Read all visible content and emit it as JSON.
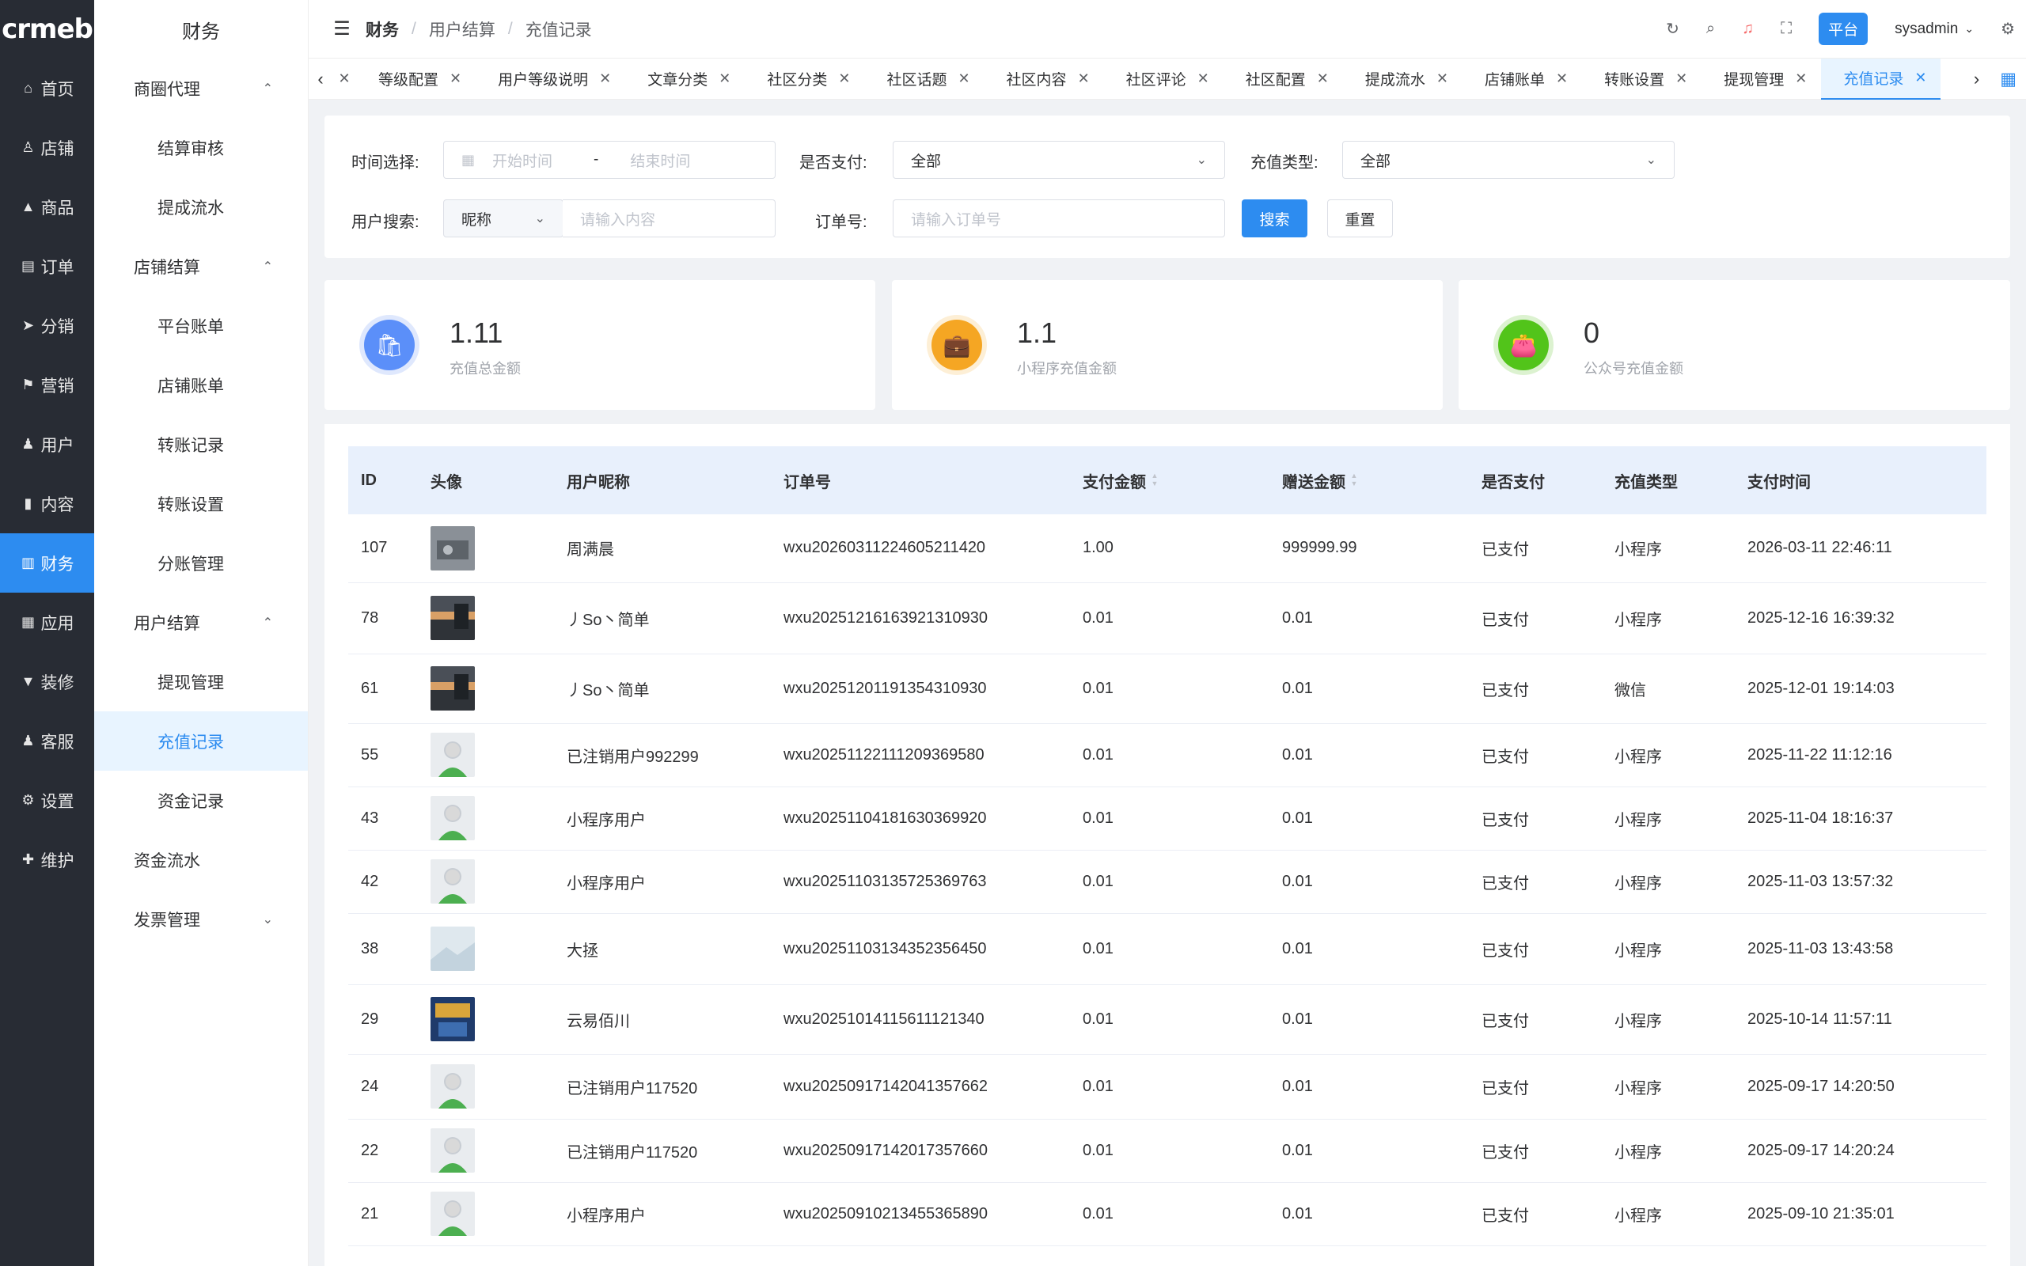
{
  "nav": {
    "logo": "crmeb",
    "items": [
      {
        "label": "首页",
        "icon": "home-icon",
        "glyph": "⌂"
      },
      {
        "label": "店铺",
        "icon": "store-icon",
        "glyph": "♙"
      },
      {
        "label": "商品",
        "icon": "bag-icon",
        "glyph": "▲"
      },
      {
        "label": "订单",
        "icon": "order-icon",
        "glyph": "▤"
      },
      {
        "label": "分销",
        "icon": "send-icon",
        "glyph": "➤"
      },
      {
        "label": "营销",
        "icon": "flag-icon",
        "glyph": "⚑"
      },
      {
        "label": "用户",
        "icon": "user-icon",
        "glyph": "♟"
      },
      {
        "label": "内容",
        "icon": "content-icon",
        "glyph": "▮"
      },
      {
        "label": "财务",
        "icon": "finance-chart-icon",
        "glyph": "▥"
      },
      {
        "label": "应用",
        "icon": "apps-icon",
        "glyph": "▦"
      },
      {
        "label": "装修",
        "icon": "brush-icon",
        "glyph": "▼"
      },
      {
        "label": "客服",
        "icon": "service-icon",
        "glyph": "♟"
      },
      {
        "label": "设置",
        "icon": "settings-icon",
        "glyph": "⚙"
      },
      {
        "label": "维护",
        "icon": "maintain-icon",
        "glyph": "✚"
      }
    ]
  },
  "sidebar": {
    "title": "财务",
    "entries": [
      {
        "type": "group",
        "label": "商圈代理",
        "arrow": "⌃"
      },
      {
        "type": "item",
        "label": "结算审核"
      },
      {
        "type": "item",
        "label": "提成流水"
      },
      {
        "type": "group",
        "label": "店铺结算",
        "arrow": "⌃"
      },
      {
        "type": "item",
        "label": "平台账单"
      },
      {
        "type": "item",
        "label": "店铺账单"
      },
      {
        "type": "item",
        "label": "转账记录"
      },
      {
        "type": "item",
        "label": "转账设置"
      },
      {
        "type": "item",
        "label": "分账管理"
      },
      {
        "type": "group",
        "label": "用户结算",
        "arrow": "⌃"
      },
      {
        "type": "item",
        "label": "提现管理"
      },
      {
        "type": "item",
        "label": "充值记录",
        "active": true
      },
      {
        "type": "item",
        "label": "资金记录"
      },
      {
        "type": "group",
        "label": "资金流水",
        "arrow": ""
      },
      {
        "type": "group",
        "label": "发票管理",
        "arrow": "⌄"
      }
    ]
  },
  "header": {
    "crumbs": [
      "财务",
      "用户结算",
      "充值记录"
    ],
    "platform_label": "平台",
    "username": "sysadmin"
  },
  "tabs": {
    "items": [
      "等级配置",
      "用户等级说明",
      "文章分类",
      "社区分类",
      "社区话题",
      "社区内容",
      "社区评论",
      "社区配置",
      "提成流水",
      "店铺账单",
      "转账设置",
      "提现管理",
      "充值记录"
    ],
    "active_index": 12
  },
  "filter": {
    "time_label": "时间选择:",
    "start_placeholder": "开始时间",
    "range_sep": "-",
    "end_placeholder": "结束时间",
    "paid_label": "是否支付:",
    "paid_value": "全部",
    "type_label": "充值类型:",
    "type_value": "全部",
    "user_search_label": "用户搜索:",
    "user_field_value": "昵称",
    "user_search_placeholder": "请输入内容",
    "order_label": "订单号:",
    "order_placeholder": "请输入订单号",
    "search_btn": "搜索",
    "reset_btn": "重置"
  },
  "stats": [
    {
      "value": "1.11",
      "label": "充值总金额",
      "color": "#5b8ff9",
      "ring": "#dfe8fd",
      "icon": "shopping-bag-icon",
      "glyph": "🛍"
    },
    {
      "value": "1.1",
      "label": "小程序充值金额",
      "color": "#f5a623",
      "ring": "#fdefd6",
      "icon": "briefcase-icon",
      "glyph": "💼"
    },
    {
      "value": "0",
      "label": "公众号充值金额",
      "color": "#52c41a",
      "ring": "#dcf2d0",
      "icon": "wallet-icon",
      "glyph": "👛"
    }
  ],
  "table": {
    "columns": [
      "ID",
      "头像",
      "用户昵称",
      "订单号",
      "支付金额",
      "赠送金额",
      "是否支付",
      "充值类型",
      "支付时间"
    ],
    "rows": [
      {
        "id": "107",
        "avatar": "photo-gray",
        "nick": "周满晨",
        "order": "wxu20260311224605211420",
        "pay": "1.00",
        "gift": "999999.99",
        "paid": "已支付",
        "type": "小程序",
        "time": "2026-03-11 22:46:11"
      },
      {
        "id": "78",
        "avatar": "photo-sunset",
        "nick": "丿So丶简单",
        "order": "wxu20251216163921310930",
        "pay": "0.01",
        "gift": "0.01",
        "paid": "已支付",
        "type": "小程序",
        "time": "2025-12-16 16:39:32"
      },
      {
        "id": "61",
        "avatar": "photo-sunset",
        "nick": "丿So丶简单",
        "order": "wxu20251201191354310930",
        "pay": "0.01",
        "gift": "0.01",
        "paid": "已支付",
        "type": "微信",
        "time": "2025-12-01 19:14:03"
      },
      {
        "id": "55",
        "avatar": "default",
        "nick": "已注销用户992299",
        "order": "wxu20251122111209369580",
        "pay": "0.01",
        "gift": "0.01",
        "paid": "已支付",
        "type": "小程序",
        "time": "2025-11-22 11:12:16"
      },
      {
        "id": "43",
        "avatar": "default",
        "nick": "小程序用户",
        "order": "wxu20251104181630369920",
        "pay": "0.01",
        "gift": "0.01",
        "paid": "已支付",
        "type": "小程序",
        "time": "2025-11-04 18:16:37"
      },
      {
        "id": "42",
        "avatar": "default",
        "nick": "小程序用户",
        "order": "wxu20251103135725369763",
        "pay": "0.01",
        "gift": "0.01",
        "paid": "已支付",
        "type": "小程序",
        "time": "2025-11-03 13:57:32"
      },
      {
        "id": "38",
        "avatar": "photo-light",
        "nick": "大拯",
        "order": "wxu20251103134352356450",
        "pay": "0.01",
        "gift": "0.01",
        "paid": "已支付",
        "type": "小程序",
        "time": "2025-11-03 13:43:58"
      },
      {
        "id": "29",
        "avatar": "photo-poster",
        "nick": "云易佰川",
        "order": "wxu20251014115611121340",
        "pay": "0.01",
        "gift": "0.01",
        "paid": "已支付",
        "type": "小程序",
        "time": "2025-10-14 11:57:11"
      },
      {
        "id": "24",
        "avatar": "default",
        "nick": "已注销用户117520",
        "order": "wxu20250917142041357662",
        "pay": "0.01",
        "gift": "0.01",
        "paid": "已支付",
        "type": "小程序",
        "time": "2025-09-17 14:20:50"
      },
      {
        "id": "22",
        "avatar": "default",
        "nick": "已注销用户117520",
        "order": "wxu20250917142017357660",
        "pay": "0.01",
        "gift": "0.01",
        "paid": "已支付",
        "type": "小程序",
        "time": "2025-09-17 14:20:24"
      },
      {
        "id": "21",
        "avatar": "default",
        "nick": "小程序用户",
        "order": "wxu20250910213455365890",
        "pay": "0.01",
        "gift": "0.01",
        "paid": "已支付",
        "type": "小程序",
        "time": "2025-09-10 21:35:01"
      }
    ]
  }
}
